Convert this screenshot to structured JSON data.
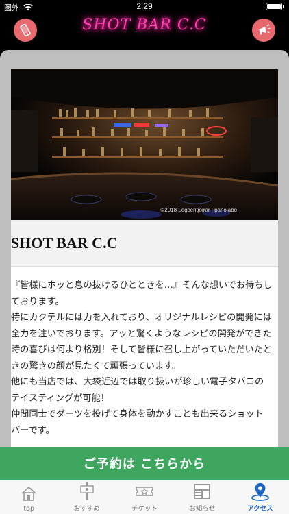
{
  "status_bar": {
    "carrier": "圏外",
    "time": "2:29"
  },
  "header": {
    "logo_text": "SHOT BAR C.C"
  },
  "hero": {
    "credit": "©2018 Legcentjoirar | panolabo"
  },
  "content": {
    "title": "SHOT BAR C.C",
    "paragraphs": [
      "『皆様にホッと息の抜けるひとときを…』そんな想いでお待ちしております。",
      "特にカクテルには力を入れており、オリジナルレシピの開発には全力を注いでおります。アッと驚くようなレシピの開発ができた時の喜びは何より格別！そして皆様に召し上がっていただいたときの驚きの顔が見たくて頑張っています。",
      "他にも当店では、大袋近辺では取り扱いが珍しい電子タバコのテイスティングが可能！",
      "仲間同士でダーツを投げて身体を動かすことも出来るショットバーです。"
    ]
  },
  "reserve": {
    "label": "ご予約は こちらから"
  },
  "tabs": [
    {
      "label": "top",
      "icon": "home-icon"
    },
    {
      "label": "おすすめ",
      "icon": "signboard-icon"
    },
    {
      "label": "チケット",
      "icon": "ticket-icon"
    },
    {
      "label": "お知らせ",
      "icon": "news-icon"
    },
    {
      "label": "アクセス",
      "icon": "location-pin-icon"
    }
  ],
  "colors": {
    "header_button": "#e86a6f",
    "logo_neon": "#ff3fb0",
    "reserve_bar": "#3fa660",
    "active_tab": "#1a66c9"
  }
}
